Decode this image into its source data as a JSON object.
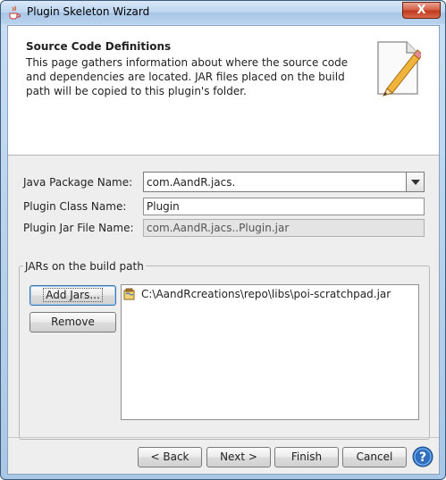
{
  "window": {
    "title": "Plugin Skeleton Wizard",
    "close_glyph": "X"
  },
  "header": {
    "title": "Source Code Definitions",
    "description": "This page gathers information about where the source code and dependencies are located. JAR files placed on the build path will be copied to this plugin's folder.",
    "art_icon": "pencil-paper-icon"
  },
  "form": {
    "package_label": "Java Package Name:",
    "package_value": "com.AandR.jacs.",
    "class_label": "Plugin Class Name:",
    "class_value": "Plugin",
    "jar_label": "Plugin Jar File Name:",
    "jar_value": "com.AandR.jacs..Plugin.jar"
  },
  "build_path": {
    "group_title": "JARs on the build path",
    "add_label": "Add Jars...",
    "remove_label": "Remove",
    "items": [
      {
        "icon": "jar-icon",
        "path": "C:\\AandRcreations\\repo\\libs\\poi-scratchpad.jar"
      }
    ]
  },
  "footer": {
    "back_label": "< Back",
    "next_label": "Next >",
    "finish_label": "Finish",
    "cancel_label": "Cancel",
    "help_icon": "help-icon"
  },
  "colors": {
    "title_bar": "#bcd5ef",
    "close_button": "#c0391f",
    "dialog_bg": "#eeeeee",
    "help_blue": "#2f6fbf"
  }
}
